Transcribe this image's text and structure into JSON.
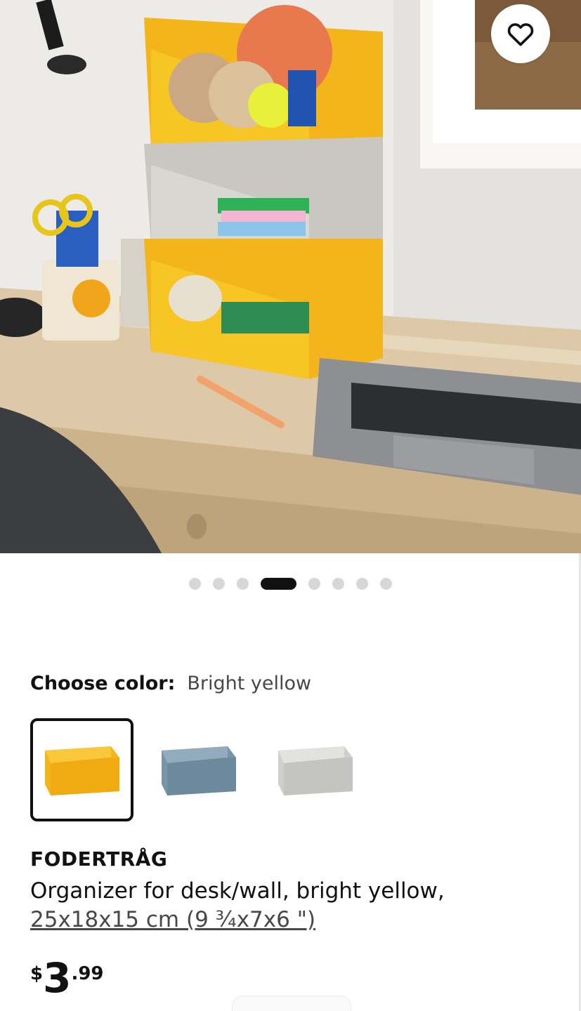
{
  "gallery": {
    "image_label": "FODERTRÅG organizer on desk",
    "dot_count": 8,
    "active_index": 3
  },
  "icons": {
    "favorite": "heart-outline-icon"
  },
  "color_picker": {
    "label": "Choose color:",
    "selected": "Bright yellow",
    "options": [
      {
        "name": "Bright yellow",
        "hex": "#f5b91c"
      },
      {
        "name": "Blue",
        "hex": "#7f9bad"
      },
      {
        "name": "Light gray",
        "hex": "#cfcfcd"
      }
    ]
  },
  "product": {
    "name": "FODERTRÅG",
    "description": "Organizer for desk/wall, bright yellow,",
    "size": "25x18x15 cm (9 ¾x7x6 \")"
  },
  "price": {
    "currency": "$",
    "integer": "3",
    "decimal": ".99"
  },
  "colors": {
    "text": "#111111",
    "muted": "#484848",
    "accent_yellow": "#f5b91c"
  }
}
